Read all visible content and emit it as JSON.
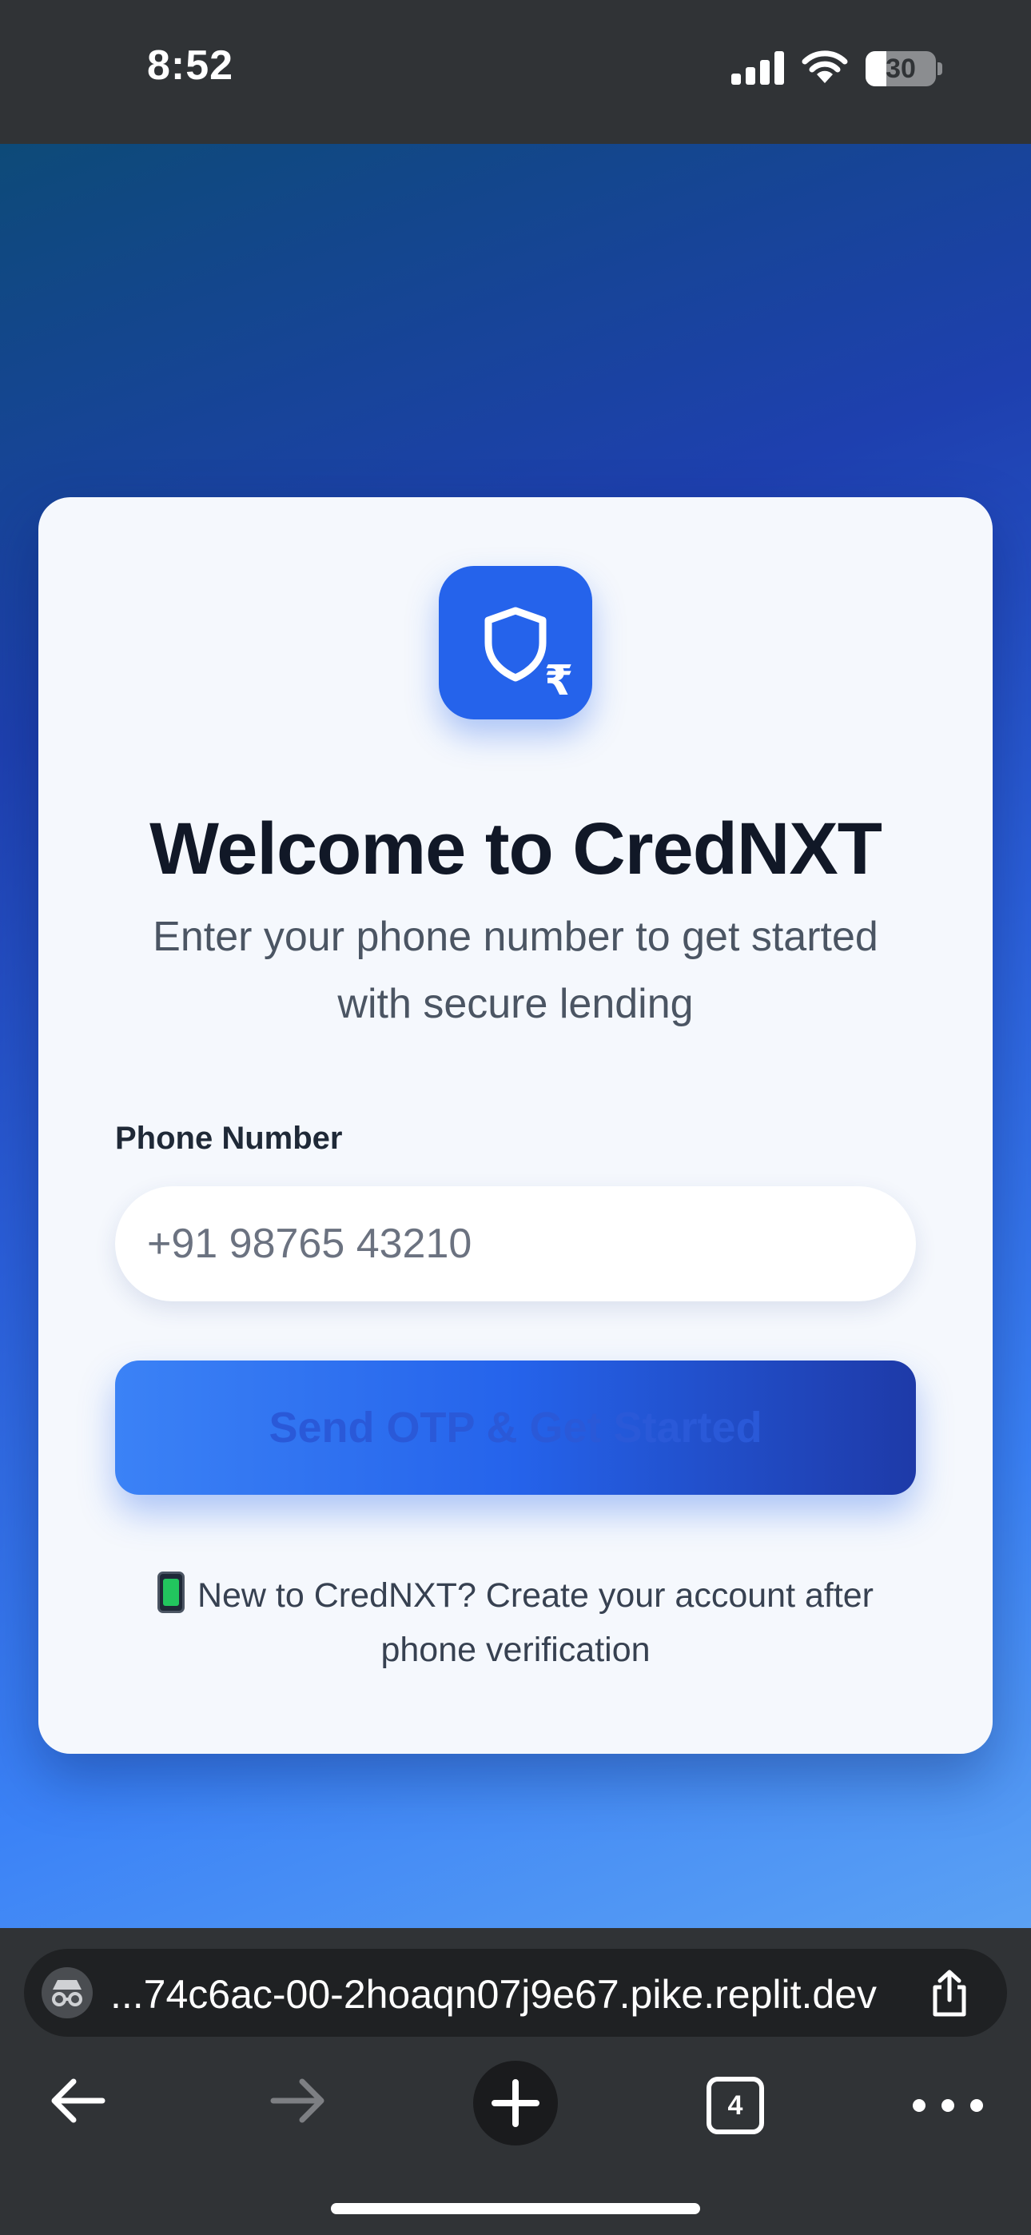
{
  "status_bar": {
    "time": "8:52",
    "battery_level": "30",
    "battery_fraction": 0.3,
    "icons": [
      "signal-icon",
      "wifi-icon",
      "battery-icon"
    ]
  },
  "colors": {
    "accent": "#2563eb",
    "title": "#111827",
    "text": "#4b5563",
    "card": "#f5f8fd",
    "chrome": "#303336"
  },
  "card": {
    "logo_icon": "shield-icon",
    "logo_badge": "₹",
    "title": "Welcome to CredNXT",
    "subtitle": "Enter your phone number to get started with secure lending",
    "phone_label": "Phone Number",
    "phone_placeholder": "+91 98765 43210",
    "cta_label": "Send OTP & Get Started",
    "note": "New to CredNXT? Create your account after phone verification",
    "note_icon": "mobile-phone-icon"
  },
  "browser": {
    "url": "...74c6ac-00-2hoaqn07j9e67.pike.replit.dev",
    "tab_count": "4",
    "icons": [
      "incognito-icon",
      "share-icon",
      "back-icon",
      "forward-icon",
      "new-tab-icon",
      "tabs-icon",
      "more-icon"
    ]
  }
}
